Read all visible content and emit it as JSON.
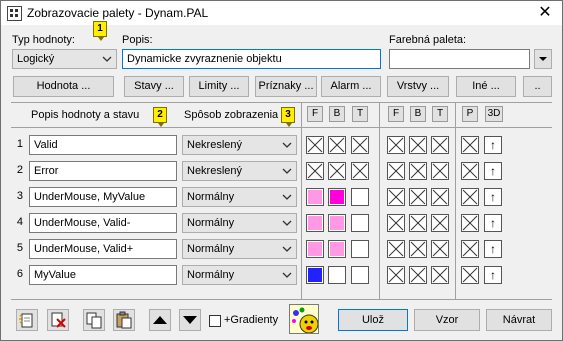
{
  "window": {
    "title": "Zobrazovacie palety - Dynam.PAL"
  },
  "top": {
    "type_label": "Typ hodnoty:",
    "type_value": "Logický",
    "desc_label": "Popis:",
    "desc_value": "Dynamicke zvyraznenie objektu",
    "palette_label": "Farebná paleta:",
    "palette_value": ""
  },
  "badges": [
    "1",
    "2",
    "3"
  ],
  "buttons": {
    "hodnota": "Hodnota ...",
    "stavy": "Stavy ...",
    "limity": "Limity ...",
    "priznaky": "Príznaky ...",
    "alarm": "Alarm ...",
    "vrstvy": "Vrstvy ...",
    "ine": "Iné ...",
    "more": ".."
  },
  "table": {
    "col_desc": "Popis hodnoty a stavu",
    "col_mode": "Spôsob zobrazenia",
    "flags_group1": [
      "F",
      "B",
      "T"
    ],
    "flags_group2": [
      "F",
      "B",
      "T"
    ],
    "flags_group3": [
      "P",
      "3D"
    ],
    "rows": [
      {
        "num": "1",
        "desc": "Valid",
        "mode": "Nekreslený"
      },
      {
        "num": "2",
        "desc": "Error",
        "mode": "Nekreslený"
      },
      {
        "num": "3",
        "desc": "UnderMouse, MyValue",
        "mode": "Normálny"
      },
      {
        "num": "4",
        "desc": "UnderMouse, Valid-",
        "mode": "Normálny"
      },
      {
        "num": "5",
        "desc": "UnderMouse, Valid+",
        "mode": "Normálny"
      },
      {
        "num": "6",
        "desc": "MyValue",
        "mode": "Normálny"
      }
    ],
    "row_colors": {
      "row3_F": "#ff99e6",
      "row3_B": "#ff00dd",
      "row4_F": "#ff99e6",
      "row4_B": "#ff99e6",
      "row5_F": "#ff99e6",
      "row5_B": "#ff99e6",
      "row6_F": "#2222ff"
    },
    "arrow_glyph": "↑"
  },
  "bottom": {
    "gradient_label": "+Gradienty",
    "save": "Ulož",
    "template": "Vzor",
    "back": "Návrat",
    "save_key": "U",
    "template_key": "V",
    "back_key": "N"
  }
}
